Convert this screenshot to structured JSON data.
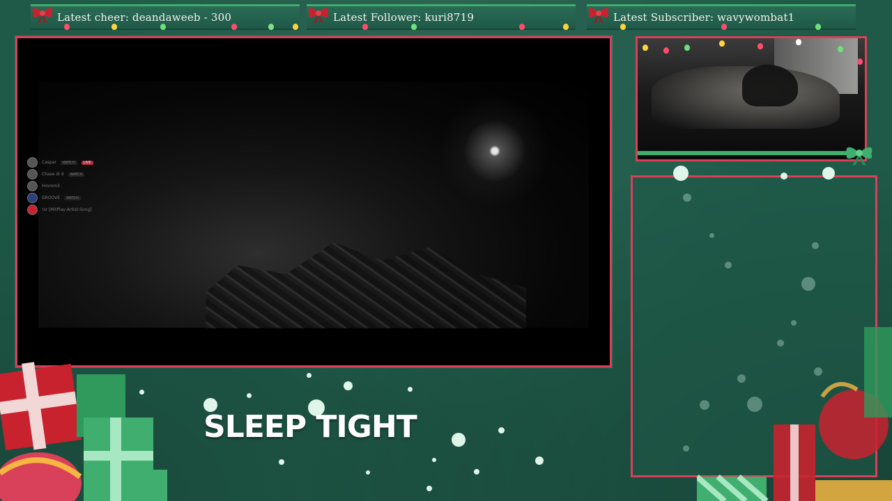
{
  "tickers": [
    {
      "label": "Latest cheer: deandaweeb - 300"
    },
    {
      "label": "Latest Follower: kuri8719"
    },
    {
      "label": "Latest Subscriber: wavywombat1"
    }
  ],
  "caption": "SLEEP TIGHT",
  "voice_chat": [
    {
      "name": "Caspar",
      "badges": [
        "WATCH",
        "LIVE"
      ]
    },
    {
      "name": "Chase di d",
      "badges": [
        "WATCH"
      ]
    },
    {
      "name": "Hmmm3",
      "badges": []
    },
    {
      "name": "GROOVE",
      "badges": [
        "WATCH"
      ]
    },
    {
      "name": "!sr [MitPlay-Artist-Song]",
      "badges": []
    }
  ],
  "colors": {
    "background": "#1f5a48",
    "frame_border": "#d9405a",
    "ribbon_green": "#3fae6f",
    "bow_red": "#c8222f"
  },
  "icons": [
    "bow-icon",
    "webcam-feed",
    "gift-decoration"
  ]
}
